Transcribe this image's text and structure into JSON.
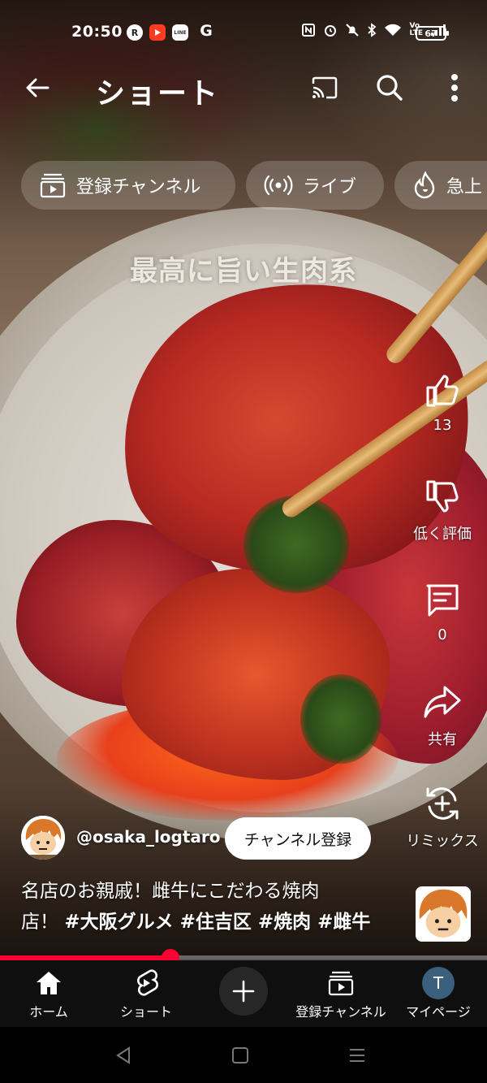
{
  "status_bar": {
    "time": "20:50",
    "app_icons": [
      "R",
      "youtube",
      "LINE",
      "G"
    ],
    "battery": "67"
  },
  "header": {
    "title": "ショート"
  },
  "chips": [
    {
      "label": "登録チャンネル",
      "icon": "subscriptions-icon"
    },
    {
      "label": "ライブ",
      "icon": "live-icon"
    },
    {
      "label": "急上",
      "icon": "trending-icon"
    }
  ],
  "video": {
    "overlay_caption": "最高に旨い生肉系"
  },
  "actions": {
    "like_count": "13",
    "dislike_label": "低く評価",
    "comment_count": "0",
    "share_label": "共有",
    "remix_label": "リミックス"
  },
  "channel": {
    "handle": "@osaka_logtaro",
    "subscribe_label": "チャンネル登録"
  },
  "description": {
    "line1": "名店のお親戚！雌牛にこだわる焼肉",
    "line2_prefix": "店！",
    "hashtags": "#大阪グルメ #住吉区 #焼肉 #雌牛"
  },
  "progress": {
    "fraction": 0.35
  },
  "bottom_nav": {
    "home": "ホーム",
    "shorts": "ショート",
    "subscriptions": "登録チャンネル",
    "me": "マイページ",
    "me_initial": "T"
  },
  "colors": {
    "accent": "#ff0033",
    "nav_bg": "#0f0f0f"
  }
}
